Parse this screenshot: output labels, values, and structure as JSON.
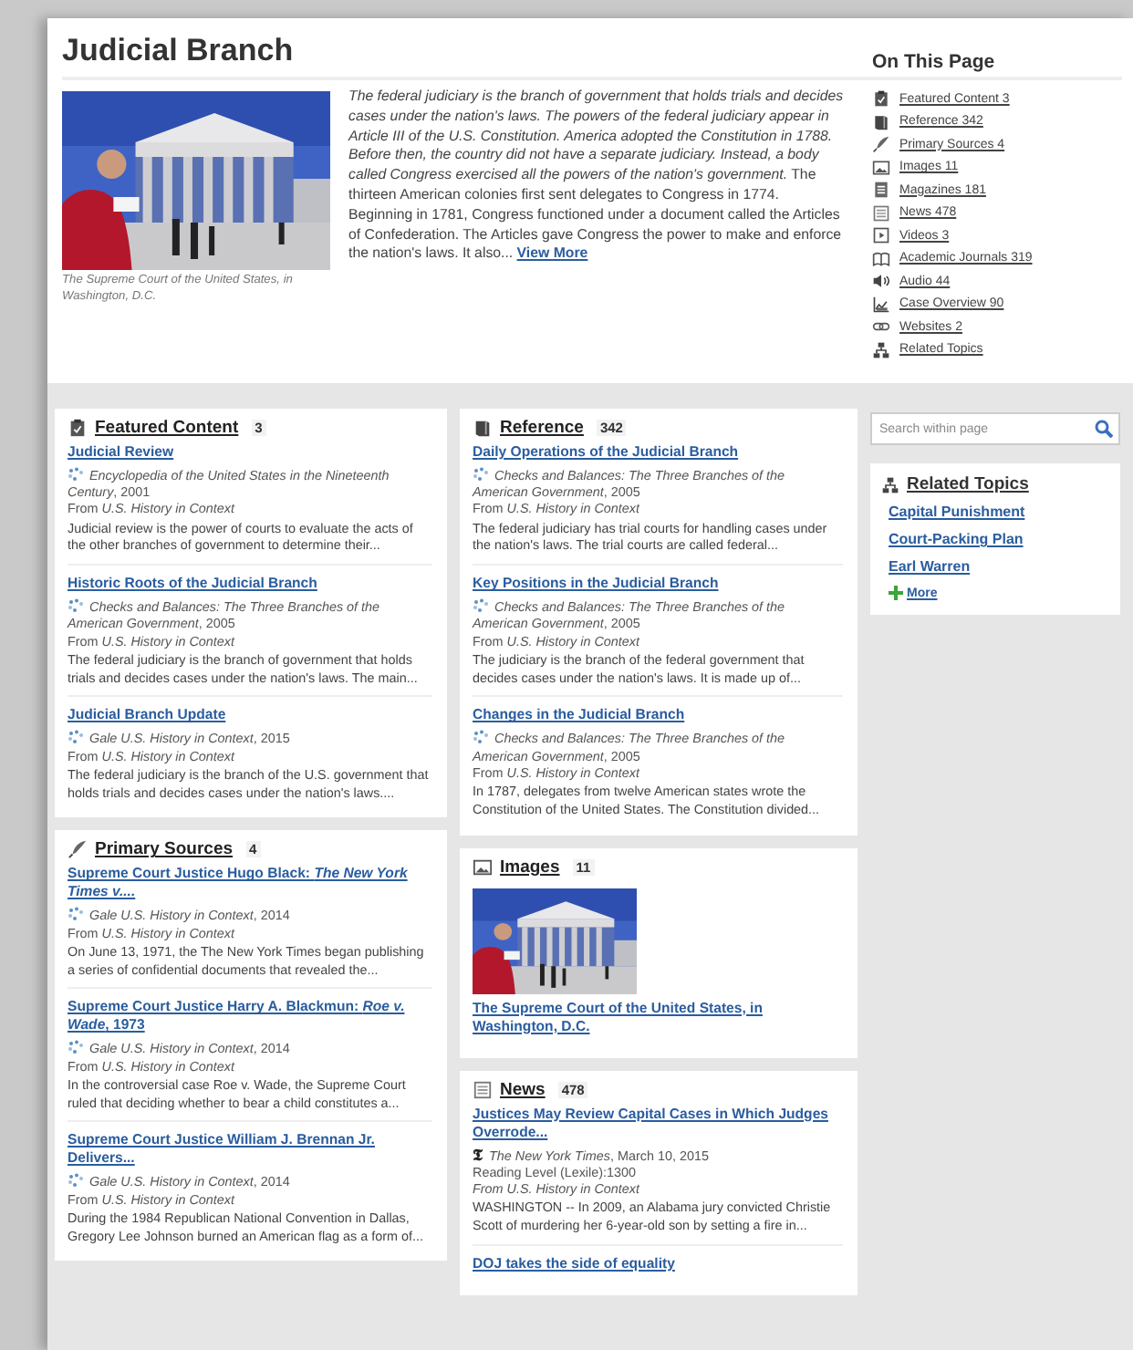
{
  "page": {
    "title": "Judicial Branch"
  },
  "overview": {
    "caption": "The Supreme Court of the United States, in Washington, D.C.",
    "text": "*The federal judiciary is the branch of government that holds trials and decides cases under the nation's laws. The powers of the federal judiciary appear in Article III of the U.S. Constitution. America adopted the Constitution in 1788. Before then, the country did not have a separate judiciary. Instead, a body called Congress exercised all the powers of the nation's government.* The thirteen American colonies first sent delegates to Congress in 1774. Beginning in 1781, Congress functioned under a document called the Articles of Confederation. The Articles gave Congress the power to make and enforce the nation's laws. It also...",
    "more_link": "View More"
  },
  "on_this_page": {
    "heading": "On This Page",
    "links": [
      "Featured Content 3",
      "Reference 342",
      "Primary Sources 4",
      "Images 11",
      "Magazines 181",
      "News 478",
      "Videos 3",
      "Academic Journals 319",
      "Audio 44",
      "Case Overview 90",
      "Websites 2",
      "Related Topics"
    ]
  },
  "columns": [
    [
      {
        "kind": "articles",
        "heading": "Featured Content",
        "count": "3",
        "items": [
          {
            "title": "Judicial Review",
            "source": "*Encyclopedia of the United States in the Nineteenth Century*, 2001",
            "from": "From *U.S. History in Context*",
            "summary": "Judicial review is the power of courts to evaluate the acts of the other branches of government to determine their..."
          },
          {
            "title": "Historic Roots of the Judicial Branch",
            "source": "*Checks and Balances: The Three Branches of the American Government*, 2005",
            "from": "From *U.S. History in Context*",
            "summary": "The federal judiciary is the branch of government that holds trials and decides cases under the nation's laws. The main..."
          },
          {
            "title": "Judicial Branch Update",
            "source": "*Gale U.S. History in Context*, 2015",
            "from": "From *U.S. History in Context*",
            "summary": "The federal judiciary is the branch of the U.S. government that holds trials and decides cases under the nation's laws...."
          }
        ]
      },
      {
        "kind": "articles",
        "heading": "Primary Sources",
        "count": "4",
        "items": [
          {
            "title": "Supreme Court Justice Hugo Black: *The New York Times v....*",
            "source": "*Gale U.S. History in Context*, 2014",
            "from": "From *U.S. History in Context*",
            "summary": "On June 13, 1971, the The New York Times began publishing a series of confidential documents that revealed the..."
          },
          {
            "title": "Supreme Court Justice Harry A. Blackmun: *Roe v. Wade*, 1973",
            "source": "*Gale U.S. History in Context*, 2014",
            "from": "From *U.S. History in Context*",
            "summary": "In the controversial case Roe v. Wade, the Supreme Court ruled that deciding whether to bear a child constitutes a..."
          },
          {
            "title": "Supreme Court Justice William J. Brennan Jr. Delivers...",
            "source": "*Gale U.S. History in Context*, 2014",
            "from": "From *U.S. History in Context*",
            "summary": "During the 1984 Republican National Convention in Dallas, Gregory Lee Johnson burned an American flag as a form of..."
          }
        ]
      }
    ],
    [
      {
        "kind": "articles",
        "heading": "Reference",
        "count": "342",
        "items": [
          {
            "title": "Daily Operations of the Judicial Branch",
            "source": "*Checks and Balances: The Three Branches of the American Government*, 2005",
            "from": "From *U.S. History in Context*",
            "summary": "The federal judiciary has trial courts for handling cases under the nation's laws. The trial courts are called federal..."
          },
          {
            "title": "Key Positions in the Judicial Branch",
            "source": "*Checks and Balances: The Three Branches of the American Government*, 2005",
            "from": "From *U.S. History in Context*",
            "summary": "The judiciary is the branch of the federal government that decides cases under the nation's laws. It is made up of..."
          },
          {
            "title": "Changes in the Judicial Branch",
            "source": "*Checks and Balances: The Three Branches of the American Government*, 2005",
            "from": "From *U.S. History in Context*",
            "summary": "In 1787, delegates from twelve American states wrote the Constitution of the United States. The Constitution divided..."
          }
        ]
      },
      {
        "kind": "images",
        "heading": "Images",
        "count": "11",
        "items": [
          {
            "title": "The Supreme Court of the United States, in Washington, D.C."
          }
        ]
      },
      {
        "kind": "articles",
        "heading": "News",
        "count": "478",
        "items": [
          {
            "title": "Justices May Review Capital Cases in Which Judges Overrode...",
            "publisher_mark": "𝕿",
            "source": "*The New York Times*, March 10, 2015",
            "reading_level": "Reading Level (Lexile):1300",
            "from": "*From U.S. History in Context*",
            "summary": "WASHINGTON -- In 2009, an Alabama jury convicted Christie Scott of murdering her 6-year-old son by setting a fire in..."
          },
          {
            "title": "DOJ takes the side of equality"
          }
        ]
      }
    ]
  ],
  "sidebar": {
    "search": {
      "placeholder": "Search within page"
    },
    "related": {
      "heading": "Related Topics",
      "links": [
        "Capital Punishment",
        "Court-Packing Plan",
        "Earl Warren"
      ],
      "more": "More"
    }
  }
}
